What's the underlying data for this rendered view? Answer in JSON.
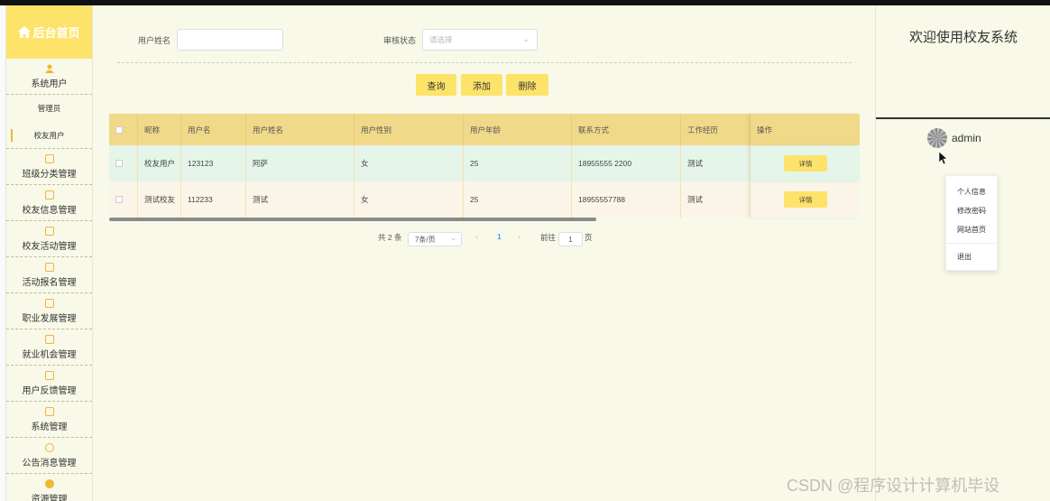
{
  "sidebar": {
    "brand": "后台首页",
    "user_section": "系统用户",
    "sub_items": [
      "管理员",
      "校友用户"
    ],
    "sections": [
      "班级分类管理",
      "校友信息管理",
      "校友活动管理",
      "活动报名管理",
      "职业发展管理",
      "就业机会管理",
      "用户反馈管理",
      "系统管理",
      "公告消息管理",
      "资源管理"
    ]
  },
  "filters": {
    "name_label": "用户姓名",
    "name_value": "",
    "status_label": "审核状态",
    "status_placeholder": "请选择"
  },
  "buttons": {
    "query": "查询",
    "add": "添加",
    "delete": "删除"
  },
  "table": {
    "headers": [
      "昵称",
      "用户名",
      "用户姓名",
      "用户性别",
      "用户年龄",
      "联系方式",
      "工作经历",
      "操作"
    ],
    "rows": [
      {
        "nickname": "校友用户",
        "username": "123123",
        "realname": "阿萨",
        "gender": "女",
        "age": "25",
        "phone": "18955555 2200",
        "work": "测试",
        "action": "详情"
      },
      {
        "nickname": "测试校友",
        "username": "112233",
        "realname": "测试",
        "gender": "女",
        "age": "25",
        "phone": "18955557788",
        "work": "测试",
        "action": "详情"
      }
    ]
  },
  "pagination": {
    "total": "共 2 条",
    "page_size": "7条/页",
    "current_page": "1",
    "goto_label": "前往",
    "goto_value": "1",
    "page_unit": "页"
  },
  "right_panel": {
    "welcome": "欢迎使用校友系统",
    "username": "admin",
    "menu": [
      "个人信息",
      "修改密码",
      "网站首页",
      "退出"
    ]
  },
  "watermark": "CSDN @程序设计计算机毕设",
  "colors": {
    "accent": "#fde36a",
    "header": "#f1d98a",
    "row1": "#e5f5ea",
    "row2": "#faf5e8"
  }
}
